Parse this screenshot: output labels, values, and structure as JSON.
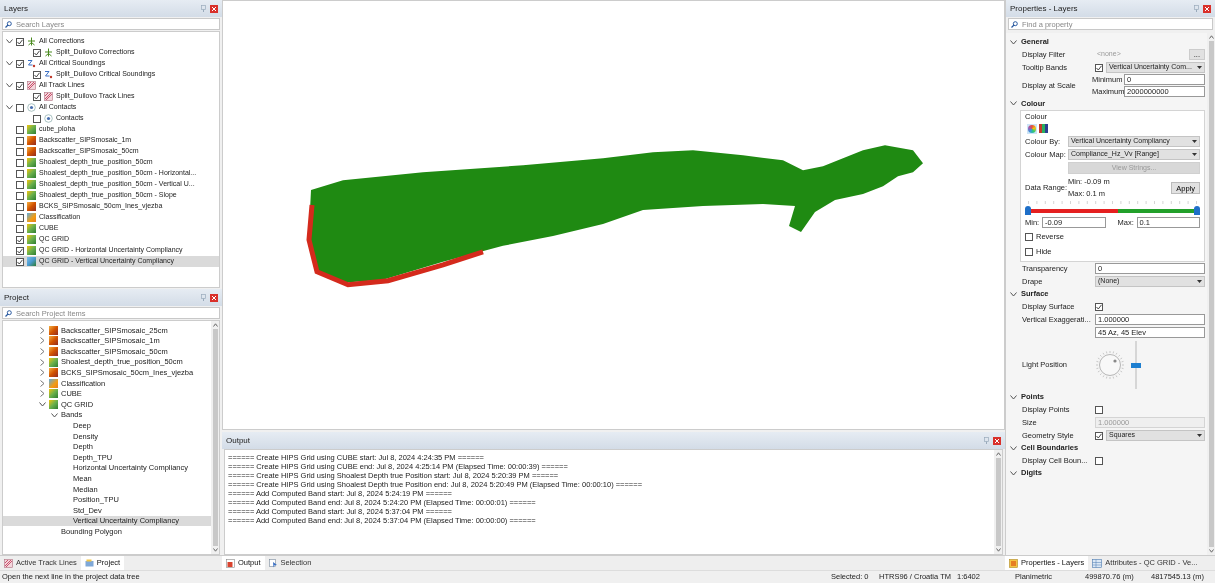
{
  "layers": {
    "title": "Layers",
    "search_placeholder": "Search Layers",
    "items": [
      {
        "label": "All Corrections",
        "kind": "corrections",
        "checked": true,
        "expanded": true,
        "selected": false,
        "children": [
          {
            "label": "Split_Duilovo Corrections",
            "kind": "corrections",
            "checked": true,
            "selected": false
          }
        ]
      },
      {
        "label": "All Critical Soundings",
        "kind": "soundings",
        "checked": true,
        "expanded": true,
        "selected": false,
        "children": [
          {
            "label": "Split_Duilovo Critical Soundings",
            "kind": "soundings",
            "checked": true,
            "selected": false
          }
        ]
      },
      {
        "label": "All Track Lines",
        "kind": "tracklines",
        "checked": true,
        "expanded": true,
        "selected": false,
        "children": [
          {
            "label": "Split_Duilovo Track Lines",
            "kind": "tracklines",
            "checked": true,
            "selected": false
          }
        ]
      },
      {
        "label": "All Contacts",
        "kind": "contacts",
        "checked": false,
        "expanded": true,
        "selected": false,
        "children": [
          {
            "label": "Contacts",
            "kind": "contacts",
            "checked": false,
            "selected": false
          }
        ]
      },
      {
        "label": "cube_ploha",
        "kind": "surface",
        "checked": false,
        "selected": false
      },
      {
        "label": "Backscatter_SIPSmosaic_1m",
        "kind": "mosaic",
        "checked": false,
        "selected": false
      },
      {
        "label": "Backscatter_SIPSmosaic_50cm",
        "kind": "mosaic",
        "checked": false,
        "selected": false
      },
      {
        "label": "Shoalest_depth_true_position_50cm",
        "kind": "surface",
        "checked": false,
        "selected": false
      },
      {
        "label": "Shoalest_depth_true_position_50cm - Horizontal...",
        "kind": "surface",
        "checked": false,
        "selected": false
      },
      {
        "label": "Shoalest_depth_true_position_50cm - Vertical U...",
        "kind": "surface",
        "checked": false,
        "selected": false
      },
      {
        "label": "Shoalest_depth_true_position_50cm - Slope",
        "kind": "surface",
        "checked": false,
        "selected": false
      },
      {
        "label": "BCKS_SIPSmosaic_50cm_Ines_vjezba",
        "kind": "mosaic",
        "checked": false,
        "selected": false
      },
      {
        "label": "Classification",
        "kind": "classification",
        "checked": false,
        "selected": false
      },
      {
        "label": "CUBE",
        "kind": "surface",
        "checked": false,
        "selected": false
      },
      {
        "label": "QC GRID",
        "kind": "surface",
        "checked": true,
        "selected": false
      },
      {
        "label": "QC GRID - Horizontal Uncertainty Compliancy",
        "kind": "surface",
        "checked": true,
        "selected": false
      },
      {
        "label": "QC GRID - Vertical Uncertainty Compliancy",
        "kind": "compliance",
        "checked": true,
        "selected": true
      }
    ]
  },
  "project": {
    "title": "Project",
    "search_placeholder": "Search Project Items",
    "items": [
      {
        "label": "Backscatter_SIPSmosaic_25cm",
        "kind": "mosaic",
        "expanded": false,
        "selected": false
      },
      {
        "label": "Backscatter_SIPSmosaic_1m",
        "kind": "mosaic",
        "expanded": false,
        "selected": false
      },
      {
        "label": "Backscatter_SIPSmosaic_50cm",
        "kind": "mosaic",
        "expanded": false,
        "selected": false
      },
      {
        "label": "Shoalest_depth_true_position_50cm",
        "kind": "surface",
        "expanded": false,
        "selected": false
      },
      {
        "label": "BCKS_SIPSmosaic_50cm_Ines_vjezba",
        "kind": "mosaic",
        "expanded": false,
        "selected": false
      },
      {
        "label": "Classification",
        "kind": "classification",
        "expanded": false,
        "selected": false
      },
      {
        "label": "CUBE",
        "kind": "surface",
        "expanded": false,
        "selected": false
      },
      {
        "label": "QC GRID",
        "kind": "surface",
        "expanded": true,
        "selected": false,
        "children": [
          {
            "label": "Bands",
            "expanded": true,
            "selected": false,
            "children": [
              {
                "label": "Deep",
                "selected": false
              },
              {
                "label": "Density",
                "selected": false
              },
              {
                "label": "Depth",
                "selected": false
              },
              {
                "label": "Depth_TPU",
                "selected": false
              },
              {
                "label": "Horizontal Uncertainty Compliancy",
                "selected": false
              },
              {
                "label": "Mean",
                "selected": false
              },
              {
                "label": "Median",
                "selected": false
              },
              {
                "label": "Position_TPU",
                "selected": false
              },
              {
                "label": "Std_Dev",
                "selected": false
              },
              {
                "label": "Vertical Uncertainty Compliancy",
                "selected": true
              }
            ]
          },
          {
            "label": "Bounding Polygon",
            "selected": false
          }
        ]
      }
    ]
  },
  "left_tabs": [
    {
      "label": "Active Track Lines",
      "kind": "tracklines",
      "selected": false
    },
    {
      "label": "Project",
      "kind": "project",
      "selected": true
    }
  ],
  "output": {
    "title": "Output",
    "lines": [
      "====== Create HIPS Grid using CUBE start: Jul 8, 2024 4:24:35 PM ======",
      "====== Create HIPS Grid using CUBE end: Jul 8, 2024 4:25:14 PM (Elapsed Time: 00:00:39) ======",
      "====== Create HIPS Grid using Shoalest Depth true Position start: Jul 8, 2024 5:20:39 PM ======",
      "====== Create HIPS Grid using Shoalest Depth true Position end: Jul 8, 2024 5:20:49 PM (Elapsed Time: 00:00:10) ======",
      "====== Add Computed Band start: Jul 8, 2024 5:24:19 PM ======",
      "====== Add Computed Band end: Jul 8, 2024 5:24:20 PM (Elapsed Time: 00:00:01) ======",
      "====== Add Computed Band start: Jul 8, 2024 5:37:04 PM ======",
      "====== Add Computed Band end: Jul 8, 2024 5:37:04 PM (Elapsed Time: 00:00:00) ======"
    ]
  },
  "center_tabs": [
    {
      "label": "Output",
      "kind": "output",
      "selected": true
    },
    {
      "label": "Selection",
      "kind": "selection",
      "selected": false
    }
  ],
  "properties": {
    "title": "Properties - Layers",
    "search_placeholder": "Find a property",
    "general": {
      "heading": "General",
      "expanded": true,
      "display_filter": {
        "label": "Display Filter",
        "value": "<none>",
        "button": "..."
      },
      "tooltip_bands": {
        "label": "Tooltip Bands",
        "checked": true,
        "value": "Vertical Uncertainty Com..."
      },
      "display_at_scale": {
        "label": "Display at Scale",
        "min_label": "Minimum",
        "min": "0",
        "max_label": "Maximum",
        "max": "2000000000"
      }
    },
    "colour": {
      "heading": "Colour",
      "expanded": true,
      "group_label": "Colour",
      "colour_by": {
        "label": "Colour By:",
        "value": "Vertical Uncertainty Compliancy"
      },
      "colour_map": {
        "label": "Colour Map:",
        "value": "Compliance_Hz_Vv [Range]"
      },
      "view_strings": {
        "label": "View Strings...",
        "disabled": true
      },
      "data_range": {
        "label": "Data Range:",
        "min_text": "Min: -0.09 m",
        "max_text": "Max: 0.1 m",
        "apply": "Apply"
      },
      "slider": {
        "thumbs": [
          {
            "level": 0
          },
          {
            "level": 1
          }
        ]
      },
      "min": {
        "label": "Min:",
        "value": "-0.09"
      },
      "max": {
        "label": "Max:",
        "value": "0.1"
      },
      "reverse": {
        "label": "Reverse",
        "checked": false
      },
      "hide": {
        "label": "Hide",
        "checked": false
      },
      "transparency": {
        "label": "Transparency",
        "value": "0"
      },
      "drape": {
        "label": "Drape",
        "value": "(None)"
      }
    },
    "surface": {
      "heading": "Surface",
      "expanded": true,
      "display_surface": {
        "label": "Display Surface",
        "checked": true
      },
      "vertical_exaggeration": {
        "label": "Vertical Exaggerati...",
        "value": "1.000000"
      },
      "light": {
        "value": "45  Az, 45 Elev",
        "label": "Light Position",
        "level": 0.5
      }
    },
    "points": {
      "heading": "Points",
      "expanded": true,
      "display_points": {
        "label": "Display Points",
        "checked": false
      },
      "size": {
        "label": "Size",
        "value": "1.000000",
        "disabled": true
      },
      "geometry_style": {
        "label": "Geometry Style",
        "checked": true,
        "value": "Squares"
      }
    },
    "cell_boundaries": {
      "heading": "Cell Boundaries",
      "expanded": true,
      "display": {
        "label": "Display Cell Boun...",
        "checked": false
      }
    },
    "digits": {
      "heading": "Digits",
      "expanded": true
    }
  },
  "right_tabs": [
    {
      "label": "Properties - Layers",
      "kind": "properties",
      "selected": true
    },
    {
      "label": "Attributes - QC GRID - Ve...",
      "kind": "attributes",
      "selected": false
    }
  ],
  "status_bar": {
    "message": "Open the next line in the project data tree",
    "selected": "Selected: 0",
    "crs": "HTRS96 / Croatia TM",
    "scale": "1:6402",
    "mode": "Planimetric",
    "easting": "499870.76 (m)",
    "northing": "4817545.13 (m)"
  }
}
